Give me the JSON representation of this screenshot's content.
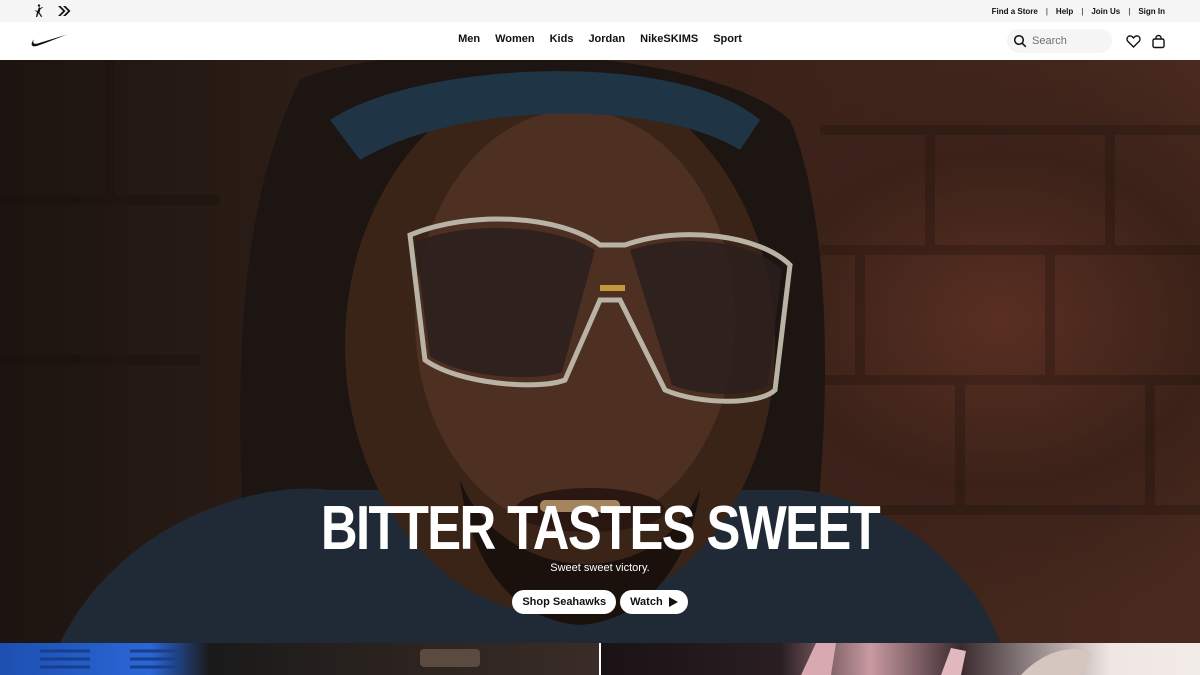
{
  "utility": {
    "links": [
      "Find a Store",
      "Help",
      "Join Us",
      "Sign In"
    ],
    "separator": "|",
    "brand_icons": [
      "jordan-jumpman-icon",
      "converse-chevron-icon"
    ]
  },
  "nav": {
    "logo": "nike-swoosh-icon",
    "items": [
      "Men",
      "Women",
      "Kids",
      "Jordan",
      "NikeSKIMS",
      "Sport"
    ],
    "search_placeholder": "Search",
    "icons": [
      "favorites-heart-icon",
      "bag-icon"
    ]
  },
  "hero": {
    "title": "BITTER TASTES SWEET",
    "subtitle": "Sweet sweet victory.",
    "buttons": [
      "Shop Seahawks",
      "Watch"
    ],
    "play_icon": "play-icon"
  },
  "colors": {
    "text": "#111111",
    "utility_bg": "#f5f5f5",
    "hero_text": "#ffffff",
    "pill_bg": "#ffffff"
  }
}
